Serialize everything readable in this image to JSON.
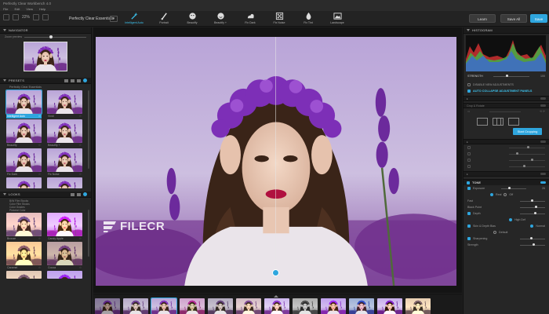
{
  "window": {
    "title": "Perfectly Clear Workbench 4.0"
  },
  "menu": [
    "File",
    "Edit",
    "View",
    "Help"
  ],
  "toolbar": {
    "zoom": "22%",
    "preset": "Perfectly Clear Essentials",
    "tools": [
      {
        "label": "Intelligent Auto",
        "icon": "intelligent-auto-icon",
        "active": true
      },
      {
        "label": "Portrait",
        "icon": "brush-icon",
        "active": false
      },
      {
        "label": "Beautify",
        "icon": "face-icon",
        "active": false
      },
      {
        "label": "Beautify +",
        "icon": "face-plus-icon",
        "active": false
      },
      {
        "label": "Fix Dark",
        "icon": "fix-dark-icon",
        "active": false
      },
      {
        "label": "Fix Noise",
        "icon": "fix-noise-icon",
        "active": false
      },
      {
        "label": "Fix Tint",
        "icon": "fix-tint-icon",
        "active": false
      },
      {
        "label": "Landscape",
        "icon": "landscape-icon",
        "active": false
      }
    ],
    "learn": "Learn",
    "save_all": "Save All",
    "save": "Save"
  },
  "navigator": {
    "title": "NAVIGATOR",
    "zoom_label": "Zoom preview"
  },
  "presets": {
    "title": "PRESETS",
    "category": "Perfectly Clear Essentials",
    "items": [
      {
        "label": "Intelligent Auto",
        "selected": true
      },
      {
        "label": "Vivid",
        "selected": false
      },
      {
        "label": "Beautify",
        "selected": false
      },
      {
        "label": "Beautify +",
        "selected": false
      },
      {
        "label": "Fix Dark",
        "selected": false
      },
      {
        "label": "Fix Noise",
        "selected": false
      }
    ]
  },
  "looks": {
    "title": "LOOKS",
    "list": [
      "B/W Film Stocks",
      "Color Film Stocks",
      "Color Grades",
      "Pictorial Color"
    ],
    "items": [
      {
        "label": "Bronze"
      },
      {
        "label": "Candy Apple"
      },
      {
        "label": "Caramel"
      },
      {
        "label": "Cocoa"
      }
    ]
  },
  "watermark": "FILECR",
  "filmstrip": {
    "count": 12,
    "selected_index": 2
  },
  "right": {
    "histogram": "HISTOGRAM",
    "strength": {
      "label": "STRENGTH",
      "value": "100"
    },
    "disable_new": "DISABLE NEW ADJUSTMENTS",
    "auto_collapse": "AUTO COLLAPSE ADJUSTMENT PANELS",
    "crop_section": "Crop & Rotate",
    "start_cropping": "Start Cropping",
    "tone": {
      "title": "TONE",
      "rows": [
        {
          "label": "Exposure",
          "value": "26"
        },
        {
          "label": "Fast",
          "value": ""
        },
        {
          "label": "Black Point",
          "value": ""
        },
        {
          "label": "Depth",
          "value": ""
        },
        {
          "label": "Skin & Depth Bias",
          "value": ""
        },
        {
          "label": "Sharpening",
          "value": ""
        },
        {
          "label": "Strength",
          "value": ""
        }
      ],
      "options": [
        {
          "label": "Real",
          "on": true
        },
        {
          "label": "Off",
          "on": false
        },
        {
          "label": "High Def",
          "on": true
        },
        {
          "label": "Normal",
          "on": true
        },
        {
          "label": "Default",
          "on": false
        }
      ]
    }
  },
  "colors": {
    "accent": "#2fa6de",
    "panel": "#262626",
    "toolbar": "#232323"
  }
}
